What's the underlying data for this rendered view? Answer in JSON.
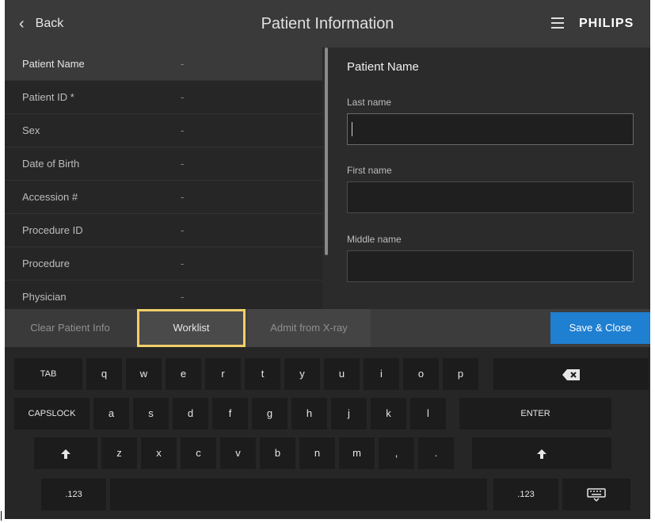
{
  "header": {
    "back_label": "Back",
    "title": "Patient Information",
    "brand": "PHILIPS"
  },
  "patient_list": [
    {
      "label": "Patient Name",
      "value": "-"
    },
    {
      "label": "Patient ID *",
      "value": "-"
    },
    {
      "label": "Sex",
      "value": "-"
    },
    {
      "label": "Date of Birth",
      "value": "-"
    },
    {
      "label": "Accession #",
      "value": "-"
    },
    {
      "label": "Procedure ID",
      "value": "-"
    },
    {
      "label": "Procedure",
      "value": "-"
    },
    {
      "label": "Physician",
      "value": "-"
    }
  ],
  "form": {
    "section_title": "Patient Name",
    "last_name_label": "Last name",
    "last_name_value": "",
    "first_name_label": "First name",
    "first_name_value": "",
    "middle_name_label": "Middle name",
    "middle_name_value": ""
  },
  "actions": {
    "clear": "Clear Patient Info",
    "worklist": "Worklist",
    "admit": "Admit from X-ray",
    "save": "Save & Close"
  },
  "keyboard": {
    "row1": [
      "TAB",
      "q",
      "w",
      "e",
      "r",
      "t",
      "y",
      "u",
      "i",
      "o",
      "p"
    ],
    "row2": [
      "CAPSLOCK",
      "a",
      "s",
      "d",
      "f",
      "g",
      "h",
      "j",
      "k",
      "l",
      "ENTER"
    ],
    "row3": [
      "z",
      "x",
      "c",
      "v",
      "b",
      "n",
      "m",
      ",",
      "."
    ],
    "numeric_left": ".123",
    "numeric_right": ".123"
  },
  "colors": {
    "accent": "#1f7fd1",
    "highlight": "#f2cf6a"
  }
}
